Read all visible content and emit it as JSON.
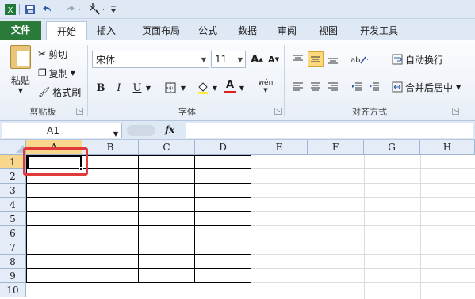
{
  "qat": {
    "save_icon": "save-icon",
    "undo_icon": "undo-icon",
    "redo_icon": "redo-icon",
    "tool_icon": "format-painter-icon"
  },
  "tabs": [
    {
      "label": "文件"
    },
    {
      "label": "开始"
    },
    {
      "label": "插入"
    },
    {
      "label": "页面布局"
    },
    {
      "label": "公式"
    },
    {
      "label": "数据"
    },
    {
      "label": "审阅"
    },
    {
      "label": "视图"
    },
    {
      "label": "开发工具"
    }
  ],
  "clipboard": {
    "paste": "粘贴",
    "cut": "剪切",
    "copy": "复制",
    "format_painter": "格式刷",
    "group_label": "剪贴板"
  },
  "font": {
    "name": "宋体",
    "size": "11",
    "bold": "B",
    "italic": "I",
    "underline": "U",
    "grow": "A",
    "shrink": "A",
    "font_color": "A",
    "phonetic": "wén",
    "group_label": "字体"
  },
  "alignment": {
    "wrap_text": "自动换行",
    "merge_center": "合并后居中",
    "group_label": "对齐方式"
  },
  "formula_bar": {
    "name_box": "A1",
    "fx": "fx",
    "formula": ""
  },
  "grid": {
    "columns": [
      "A",
      "B",
      "C",
      "D",
      "E",
      "F",
      "G",
      "H"
    ],
    "rows": [
      "1",
      "2",
      "3",
      "4",
      "5",
      "6",
      "7",
      "8",
      "9",
      "10"
    ],
    "selected_cell": "A1"
  },
  "colors": {
    "file_tab": "#2a7a3a",
    "highlight": "#e03a3a",
    "selected_header": "#f8d68c"
  }
}
